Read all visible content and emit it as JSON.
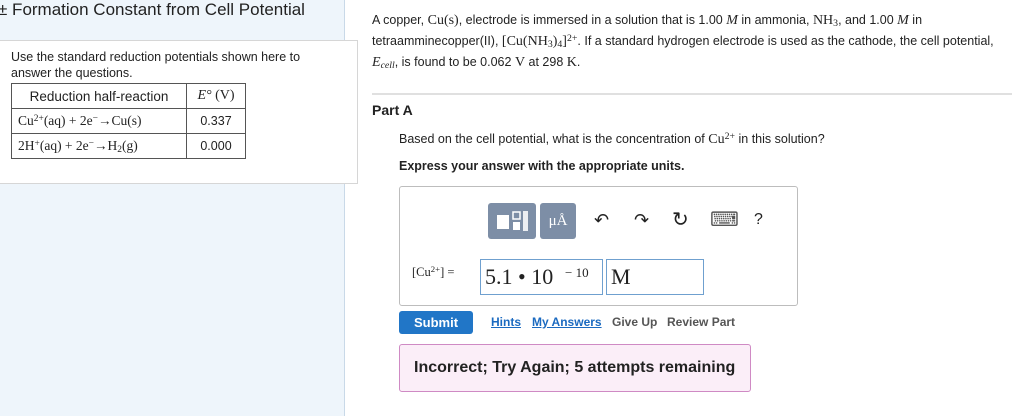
{
  "left_panel": {
    "title": "± Formation Constant from Cell Potential",
    "instructions": "Use the standard reduction potentials shown here to answer the questions.",
    "table": {
      "header_reaction": "Reduction half-reaction",
      "header_potential_symbol": "E°",
      "header_potential_unit": "(V)",
      "rows": [
        {
          "reaction_lhs": "Cu",
          "reaction_lhs_charge": "2+",
          "reaction_rest": "(aq) + 2e",
          "electron_charge": "−",
          "arrow": "→",
          "product": "Cu(s)",
          "product_pre": "",
          "product_sub": "",
          "product_post": "",
          "potential": "0.337"
        },
        {
          "reaction_lhs": "2H",
          "reaction_lhs_charge": "+",
          "reaction_rest": "(aq) + 2e",
          "electron_charge": "−",
          "arrow": "→",
          "product": "",
          "product_pre": "H",
          "product_sub": "2",
          "product_post": "(g)",
          "potential": "0.000"
        }
      ]
    }
  },
  "problem": {
    "p1": "A copper, ",
    "cu_s": "Cu(s)",
    "p2": ", electrode is immersed in a solution that is 1.00 ",
    "m1": "M",
    "p3": " in ammonia, ",
    "nh3": "NH",
    "nh3_sub": "3",
    "p4": ", and 1.00 ",
    "m2": "M",
    "p5": " in tetraamminecopper(II), ",
    "complex_a": "[Cu(NH",
    "complex_sub3": "3",
    "complex_b": ")",
    "complex_sub4": "4",
    "complex_c": "]",
    "complex_charge": "2+",
    "p6": ". If a standard hydrogen electrode is used as the cathode, the cell potential, ",
    "ecell": "E",
    "ecell_sub": "cell",
    "p7": ", is found to be 0.062 ",
    "volt": "V",
    "p8": " at 298 ",
    "kelvin": "K",
    "p9": "."
  },
  "part_a": {
    "label": "Part A",
    "question_pre": "Based on the cell potential, what is the concentration of ",
    "question_ion": "Cu",
    "question_ion_charge": "2+",
    "question_post": " in this solution?",
    "express": "Express your answer with the appropriate units.",
    "toolbar": {
      "units_glyph": "μÅ",
      "undo_glyph": "↶",
      "redo_glyph": "↷",
      "reset_glyph": "↻",
      "keyboard_glyph": "⌨",
      "help_glyph": "?"
    },
    "answer_label_pre": "[Cu",
    "answer_label_charge": "2+",
    "answer_label_post": "] =",
    "answer_value": "5.1 • 10",
    "answer_exponent": "− 10",
    "answer_unit": "M"
  },
  "actions": {
    "submit": "Submit",
    "hints": "Hints",
    "my_answers": "My Answers",
    "give_up": "Give Up",
    "review_part": "Review Part"
  },
  "feedback": "Incorrect; Try Again; 5 attempts remaining",
  "colors": {
    "submit_blue": "#2176c7",
    "toolbar_slate": "#7d8ea6",
    "feedback_bg": "#fbeef8",
    "feedback_border": "#cf8ac4",
    "left_panel_bg": "#eef5fb"
  }
}
